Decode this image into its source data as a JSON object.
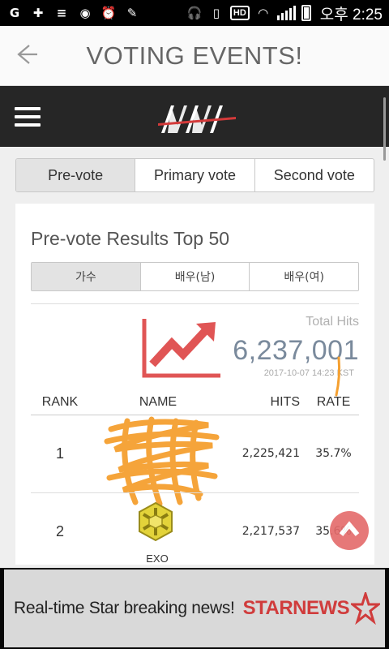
{
  "status_bar": {
    "time": "오후 2:25",
    "hd_label": "HD",
    "icons": [
      "g-icon",
      "plus-icon",
      "list-icon",
      "sync-icon",
      "alarm-icon",
      "broom-icon",
      "headset-icon",
      "vibrate-icon",
      "wifi-icon",
      "signal-icon",
      "battery-icon"
    ]
  },
  "header": {
    "title": "VOTING EVENTS!",
    "back_icon": "arrow-left-icon"
  },
  "nav": {
    "menu_icon": "hamburger-icon",
    "logo": "MAMA logo"
  },
  "vote_tabs": [
    {
      "label": "Pre-vote",
      "active": true
    },
    {
      "label": "Primary vote",
      "active": false
    },
    {
      "label": "Second vote",
      "active": false
    }
  ],
  "results": {
    "title": "Pre-vote Results Top 50",
    "category_tabs": [
      {
        "label": "가수",
        "active": true
      },
      {
        "label": "배우(남)",
        "active": false
      },
      {
        "label": "배우(여)",
        "active": false
      }
    ],
    "total_hits_label": "Total Hits",
    "total_hits_value": "6,237,001",
    "timestamp": "2017-10-07 14:23 KST",
    "columns": [
      "RANK",
      "NAME",
      "HITS",
      "RATE"
    ],
    "rows": [
      {
        "rank": "1",
        "name": "",
        "hits": "2,225,421",
        "rate": "35.7%"
      },
      {
        "rank": "2",
        "name": "EXO",
        "hits": "2,217,537",
        "rate": "35.6%"
      }
    ]
  },
  "ad": {
    "text": "Real-time Star breaking news!",
    "brand": "STARNEWS"
  },
  "colors": {
    "accent_red": "#e46a6a",
    "chart_red": "#e05555",
    "hits_blue": "#7a8a9c",
    "scribble_orange": "#f5a030"
  }
}
